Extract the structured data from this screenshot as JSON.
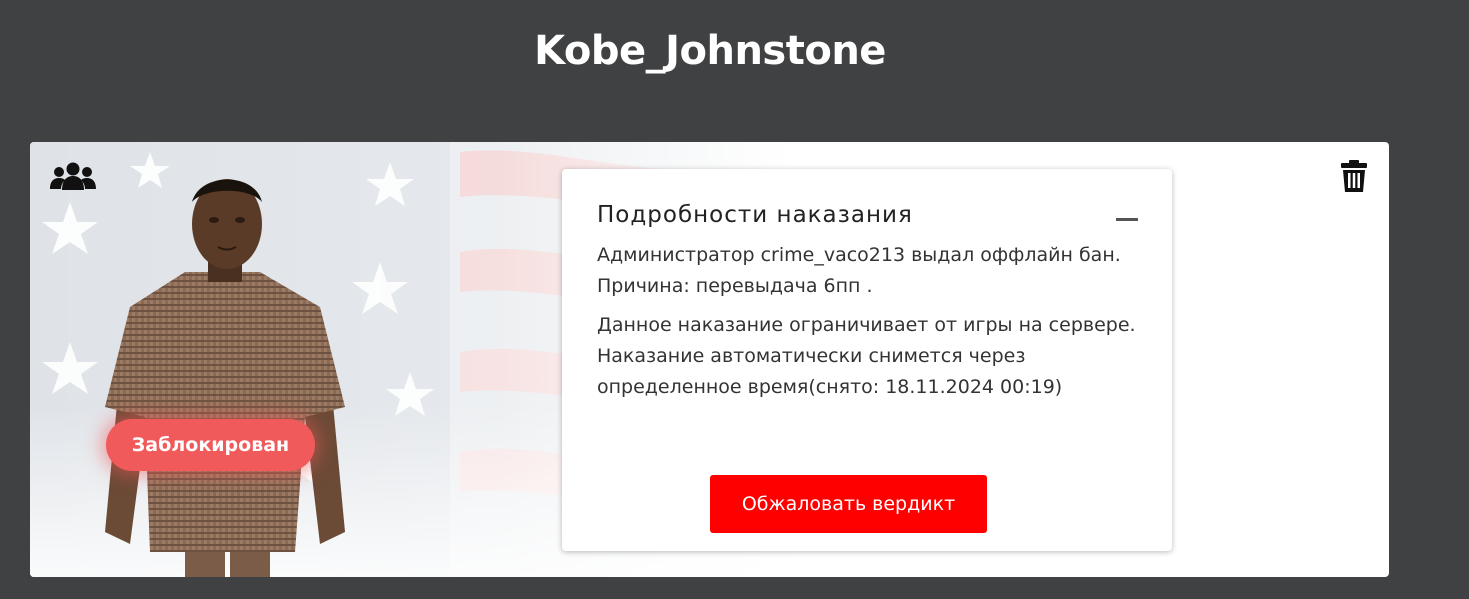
{
  "header": {
    "title": "Kobe_Johnstone"
  },
  "profile": {
    "status_label": "Заблокирован",
    "status_color": "#f05a5a",
    "background": "american-flag",
    "group_icon": "users-icon",
    "delete_icon": "trash-icon"
  },
  "punishment": {
    "title": "Подробности наказания",
    "collapse_icon": "minus-icon",
    "line_1": "Администратор crime_vaco213 выдал оффлайн бан.",
    "line_2": "Причина: перевыдача 6пп .",
    "description": "Данное наказание ограничивает от игры на сервере. Наказание автоматически снимется через определенное время(снято: 18.11.2024 00:19)",
    "appeal_label": "Обжаловать вердикт",
    "appeal_color": "#ff0000"
  }
}
